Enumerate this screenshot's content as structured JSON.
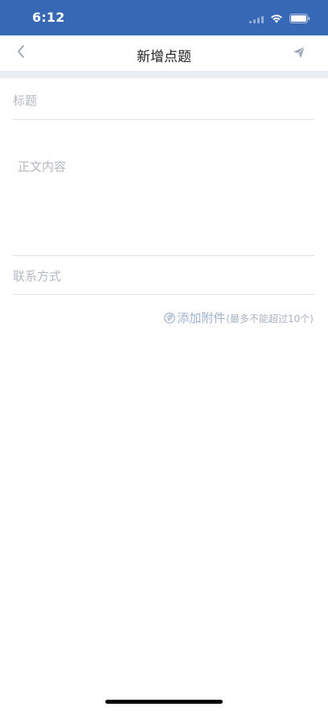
{
  "status_bar": {
    "time": "6:12",
    "background_color": "#3768b5",
    "icons": [
      "signal-icon",
      "wifi-icon",
      "battery-icon"
    ]
  },
  "nav": {
    "title": "新增点题",
    "back_icon": "chevron-left-icon",
    "send_icon": "paper-plane-icon"
  },
  "form": {
    "title_placeholder": "标题",
    "title_value": "",
    "content_placeholder": "正文内容",
    "content_value": "",
    "contact_placeholder": "联系方式",
    "contact_value": ""
  },
  "attachment": {
    "icon": "paperclip-icon",
    "label": "添加附件",
    "hint": "(最多不能超过10个)"
  }
}
